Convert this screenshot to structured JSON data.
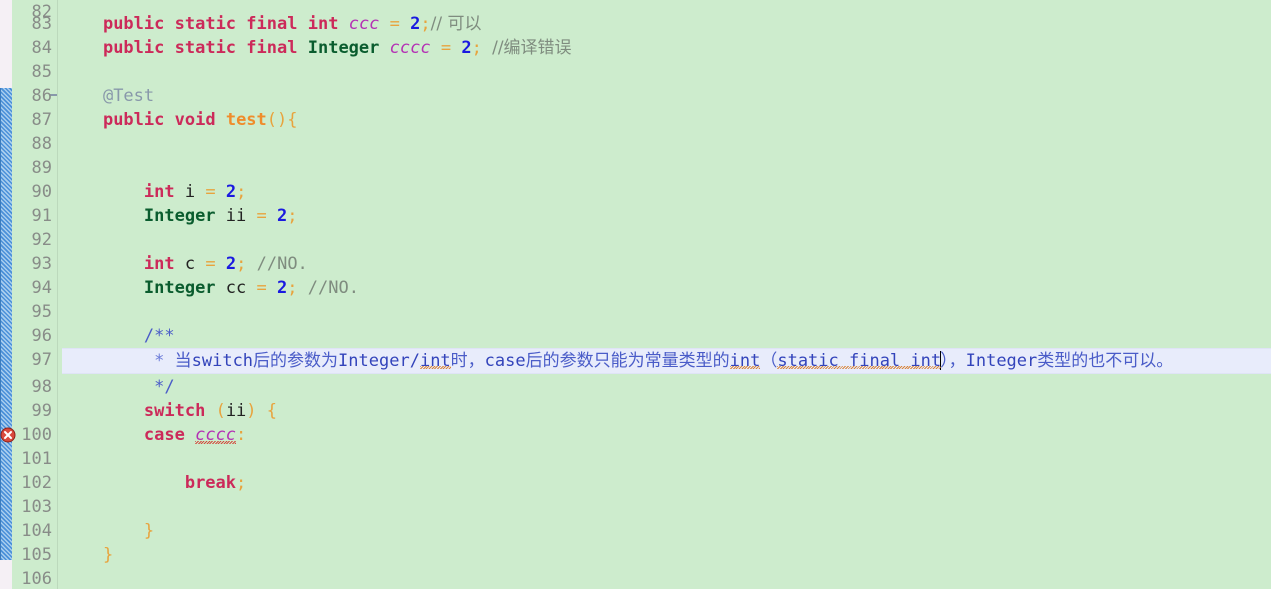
{
  "editor": {
    "background_color": "#cdeccd",
    "gutter_color": "#cdeccd",
    "line_number_color": "#888c88",
    "current_line_highlight_color": "#e8ecfb",
    "change_bar_color": "#4a90d9",
    "first_visible_line": 82,
    "last_visible_line": 106,
    "caret_line": 97,
    "error_lines": [
      100
    ]
  },
  "icons": {
    "error_marker": "error-circle-x-icon",
    "fold_marker": "code-fold-collapse-icon"
  },
  "lines": [
    {
      "n": "82",
      "text": ""
    },
    {
      "n": "83",
      "text": "    public static final int ccc = 2;// 可以"
    },
    {
      "n": "84",
      "text": "    public static final Integer cccc = 2; //编译错误"
    },
    {
      "n": "85",
      "text": ""
    },
    {
      "n": "86",
      "text": "    @Test"
    },
    {
      "n": "87",
      "text": "    public void test(){"
    },
    {
      "n": "88",
      "text": ""
    },
    {
      "n": "89",
      "text": ""
    },
    {
      "n": "90",
      "text": "        int i = 2;"
    },
    {
      "n": "91",
      "text": "        Integer ii = 2;"
    },
    {
      "n": "92",
      "text": ""
    },
    {
      "n": "93",
      "text": "        int c = 2; //NO."
    },
    {
      "n": "94",
      "text": "        Integer cc = 2; //NO."
    },
    {
      "n": "95",
      "text": ""
    },
    {
      "n": "96",
      "text": "        /**"
    },
    {
      "n": "97",
      "text": "         * 当switch后的参数为Integer/int时，case后的参数只能为常量类型的int（static final int），Integer类型的也不可以。"
    },
    {
      "n": "98",
      "text": "         */"
    },
    {
      "n": "99",
      "text": "        switch (ii) {"
    },
    {
      "n": "100",
      "text": "        case cccc:"
    },
    {
      "n": "101",
      "text": ""
    },
    {
      "n": "102",
      "text": "            break;"
    },
    {
      "n": "103",
      "text": ""
    },
    {
      "n": "104",
      "text": "        }"
    },
    {
      "n": "105",
      "text": "    }"
    },
    {
      "n": "106",
      "text": ""
    }
  ],
  "tokens": {
    "kw_public": "public",
    "kw_static": "static",
    "kw_final": "final",
    "kw_int": "int",
    "kw_void": "void",
    "kw_switch": "switch",
    "kw_case": "case",
    "kw_break": "break",
    "type_integer": "Integer",
    "ident_ccc": "ccc",
    "ident_cccc": "cccc",
    "ident_i": "i",
    "ident_ii": "ii",
    "ident_c": "c",
    "ident_cc": "cc",
    "num_2": "2",
    "annotation_test": "@Test",
    "method_test": "test",
    "comment_keyi": "// 可以",
    "comment_bianyicuowu": "//编译错误",
    "comment_no": "//NO.",
    "doc_open": "/**",
    "doc_close": "*/",
    "doc_star": "*",
    "doc_body_1": "当",
    "doc_body_switch": "switch",
    "doc_body_2": "后的参数为",
    "doc_body_integer": "Integer",
    "doc_body_slash": "/",
    "doc_body_int1": "int",
    "doc_body_3": "时，",
    "doc_body_case": "case",
    "doc_body_4": "后的参数只能为常量类型的",
    "doc_body_int2": "int",
    "doc_body_5": "（",
    "doc_body_staticfinalint": "static final int",
    "doc_body_6": "），",
    "doc_body_integer2": "Integer",
    "doc_body_7": "类型的也不可以。"
  },
  "colors": {
    "keyword": "#cc2a5a",
    "type": "#0a5c2e",
    "number": "#1a1ae0",
    "operator": "#e8a33d",
    "field": "#b431b4",
    "comment": "#7f8c7f",
    "annotation": "#8898aa",
    "method": "#ef8c2b",
    "javadoc": "#4a5cc8",
    "error": "#cc2222"
  }
}
